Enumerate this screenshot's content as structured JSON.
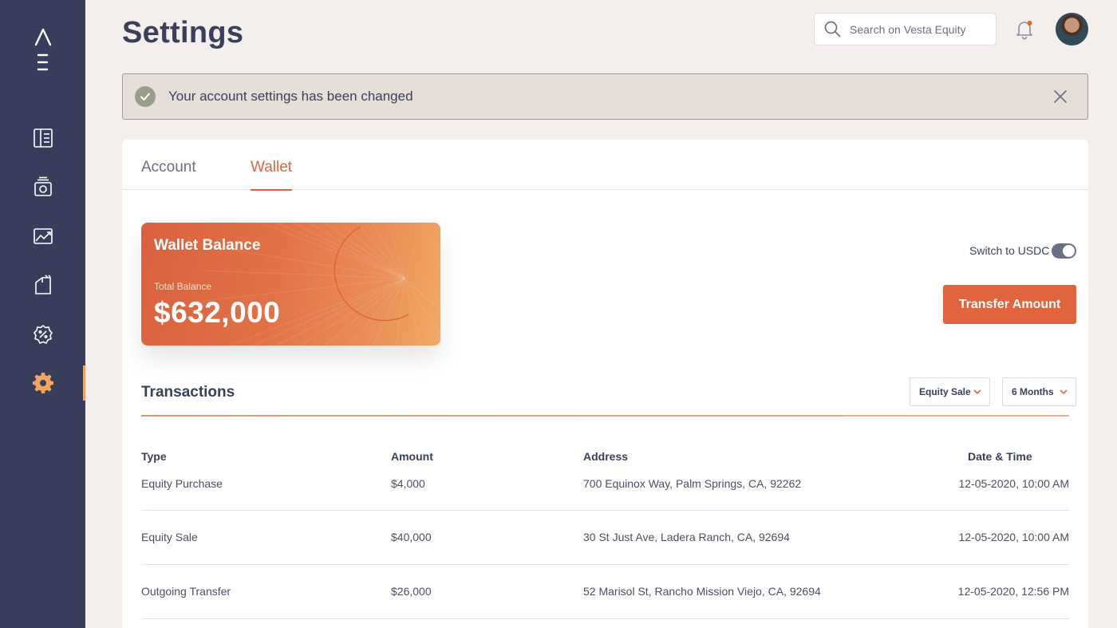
{
  "header": {
    "title": "Settings",
    "search_placeholder": "Search on Vesta Equity"
  },
  "alert": {
    "message": "Your account settings has been changed"
  },
  "tabs": [
    {
      "label": "Account",
      "active": false
    },
    {
      "label": "Wallet",
      "active": true
    }
  ],
  "wallet": {
    "title": "Wallet Balance",
    "balance_label": "Total Balance",
    "balance": "$632,000"
  },
  "controls": {
    "switch_label": "Switch to USDC",
    "transfer_button": "Transfer Amount"
  },
  "transactions": {
    "title": "Transactions",
    "filter_type": "Equity Sale",
    "filter_period": "6 Months",
    "columns": [
      "Type",
      "Amount",
      "Address",
      "Date & Time"
    ],
    "rows": [
      {
        "type": "Equity Purchase",
        "amount": "$4,000",
        "address": "700 Equinox Way, Palm Springs, CA, 92262",
        "datetime": "12-05-2020, 10:00 AM"
      },
      {
        "type": "Equity Sale",
        "amount": "$40,000",
        "address": "30 St Just Ave, Ladera Ranch, CA, 92694",
        "datetime": "12-05-2020, 10:00 AM"
      },
      {
        "type": "Outgoing Transfer",
        "amount": "$26,000",
        "address": "52 Marisol St, Rancho Mission Viejo, CA, 92694",
        "datetime": "12-05-2020, 12:56 PM"
      }
    ]
  },
  "sidebar": {
    "items": [
      {
        "icon": "dashboard-icon",
        "active": false
      },
      {
        "icon": "equity-icon",
        "active": false
      },
      {
        "icon": "chart-icon",
        "active": false
      },
      {
        "icon": "property-icon",
        "active": false
      },
      {
        "icon": "discount-icon",
        "active": false
      },
      {
        "icon": "gear-icon",
        "active": true
      }
    ]
  },
  "colors": {
    "sidebar_bg": "#383d5c",
    "accent": "#e0653f",
    "active_icon": "#f3a560",
    "text": "#3a3f5c"
  }
}
